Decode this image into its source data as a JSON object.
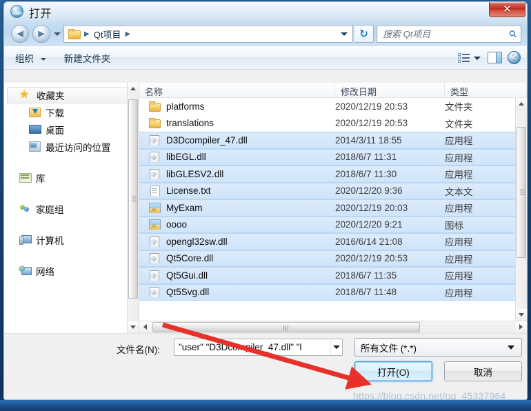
{
  "window": {
    "title": "打开",
    "close_label": "✕"
  },
  "nav": {
    "back_icon": "◄",
    "forward_icon": "►",
    "breadcrumb": [
      "Qt项目"
    ],
    "separator": "▶",
    "refresh_icon": "↻"
  },
  "search": {
    "placeholder": "搜索 Qt项目",
    "icon": "search-icon"
  },
  "toolbar": {
    "organize_label": "组织",
    "new_folder_label": "新建文件夹",
    "view_icon": "list-view-icon",
    "pane_icon": "preview-pane-icon",
    "help_icon": "help-icon"
  },
  "sidebar": {
    "items": [
      {
        "label": "收藏夹",
        "icon": "star-icon",
        "level": "top",
        "selected": true
      },
      {
        "label": "下载",
        "icon": "download-folder-icon",
        "level": "child",
        "selected": false
      },
      {
        "label": "桌面",
        "icon": "desktop-icon",
        "level": "child",
        "selected": false
      },
      {
        "label": "最近访问的位置",
        "icon": "recent-places-icon",
        "level": "child",
        "selected": false
      },
      {
        "label": "库",
        "icon": "library-icon",
        "level": "top",
        "selected": false
      },
      {
        "label": "家庭组",
        "icon": "homegroup-icon",
        "level": "top",
        "selected": false
      },
      {
        "label": "计算机",
        "icon": "computer-icon",
        "level": "top",
        "selected": false
      },
      {
        "label": "网络",
        "icon": "network-icon",
        "level": "top",
        "selected": false
      }
    ]
  },
  "file_list": {
    "columns": [
      "名称",
      "修改日期",
      "类型"
    ],
    "sort_column": "名称",
    "rows": [
      {
        "name": "platforms",
        "date": "2020/12/19 20:53",
        "type": "文件夹",
        "icon": "folder-icon",
        "selected": false
      },
      {
        "name": "translations",
        "date": "2020/12/19 20:53",
        "type": "文件夹",
        "icon": "folder-icon",
        "selected": false
      },
      {
        "name": "D3Dcompiler_47.dll",
        "date": "2014/3/11 18:55",
        "type": "应用程",
        "icon": "dll-icon",
        "selected": true
      },
      {
        "name": "libEGL.dll",
        "date": "2018/6/7 11:31",
        "type": "应用程",
        "icon": "dll-icon",
        "selected": true
      },
      {
        "name": "libGLESV2.dll",
        "date": "2018/6/7 11:30",
        "type": "应用程",
        "icon": "dll-icon",
        "selected": true
      },
      {
        "name": "License.txt",
        "date": "2020/12/20 9:36",
        "type": "文本文",
        "icon": "text-file-icon",
        "selected": true
      },
      {
        "name": "MyExam",
        "date": "2020/12/19 20:03",
        "type": "应用程",
        "icon": "image-icon",
        "selected": true
      },
      {
        "name": "oooo",
        "date": "2020/12/20 9:21",
        "type": "图标",
        "icon": "image-icon",
        "selected": true
      },
      {
        "name": "opengl32sw.dll",
        "date": "2016/6/14 21:08",
        "type": "应用程",
        "icon": "dll-icon",
        "selected": true
      },
      {
        "name": "Qt5Core.dll",
        "date": "2020/12/19 20:53",
        "type": "应用程",
        "icon": "dll-icon",
        "selected": true
      },
      {
        "name": "Qt5Gui.dll",
        "date": "2018/6/7 11:35",
        "type": "应用程",
        "icon": "dll-icon",
        "selected": true
      },
      {
        "name": "Qt5Svg.dll",
        "date": "2018/6/7 11:48",
        "type": "应用程",
        "icon": "dll-icon",
        "selected": true
      }
    ]
  },
  "footer": {
    "filename_label": "文件名(N):",
    "filename_value": "\"user\" \"D3Dcompiler_47.dll\" \"l",
    "filter_value": "所有文件 (*.*)",
    "open_label": "打开(O)",
    "cancel_label": "取消"
  },
  "watermark": {
    "text": "https://blog.csdn.net/qq_45337964"
  },
  "colors": {
    "selection": "#cfe4fa",
    "accent": "#3c93d0",
    "close_red": "#b8291c",
    "annotation_red": "#e8312a"
  }
}
